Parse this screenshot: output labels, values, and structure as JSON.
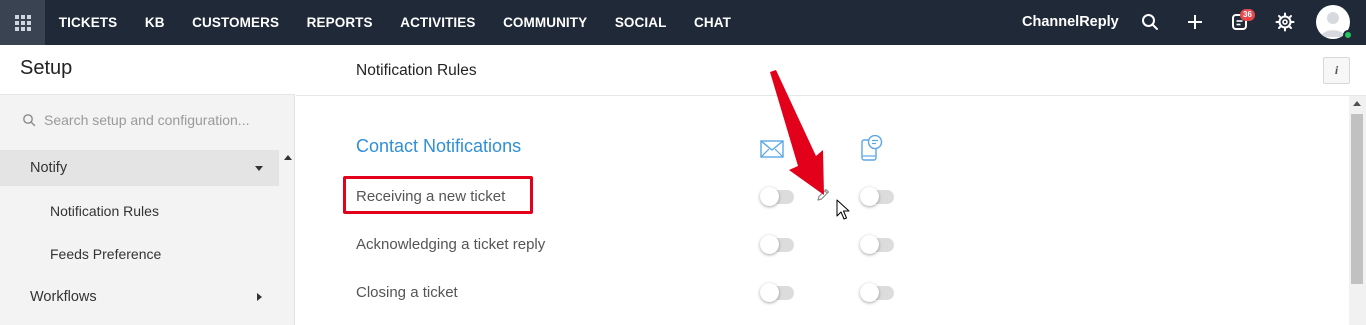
{
  "topbar": {
    "nav_items": [
      "TICKETS",
      "KB",
      "CUSTOMERS",
      "REPORTS",
      "ACTIVITIES",
      "COMMUNITY",
      "SOCIAL",
      "CHAT"
    ],
    "brand": "ChannelReply",
    "notification_count": "36",
    "icons": [
      "apps-grid-icon",
      "search-icon",
      "plus-icon",
      "notifications-icon",
      "settings-gear-icon",
      "avatar"
    ]
  },
  "sidebar": {
    "title": "Setup",
    "search_placeholder": "Search setup and configuration...",
    "menu": {
      "notify_label": "Notify",
      "sub_items": [
        "Notification Rules",
        "Feeds Preference"
      ],
      "workflows_label": "Workflows"
    }
  },
  "main": {
    "page_title": "Notification Rules",
    "info_label": "i",
    "section_title": "Contact Notifications",
    "columns": [
      "email-icon",
      "mobile-chat-icon"
    ],
    "rows": [
      {
        "label": "Receiving a new ticket",
        "email_enabled": false,
        "mobile_enabled": false,
        "highlighted": true
      },
      {
        "label": "Acknowledging a ticket reply",
        "email_enabled": false,
        "mobile_enabled": false,
        "highlighted": false
      },
      {
        "label": "Closing a ticket",
        "email_enabled": false,
        "mobile_enabled": false,
        "highlighted": false
      }
    ]
  },
  "colors": {
    "topbar_bg": "#1f2937",
    "accent_blue": "#2f8fd8",
    "highlight_red": "#e3001b",
    "badge_red": "#e5484d",
    "online_green": "#22c55e"
  }
}
